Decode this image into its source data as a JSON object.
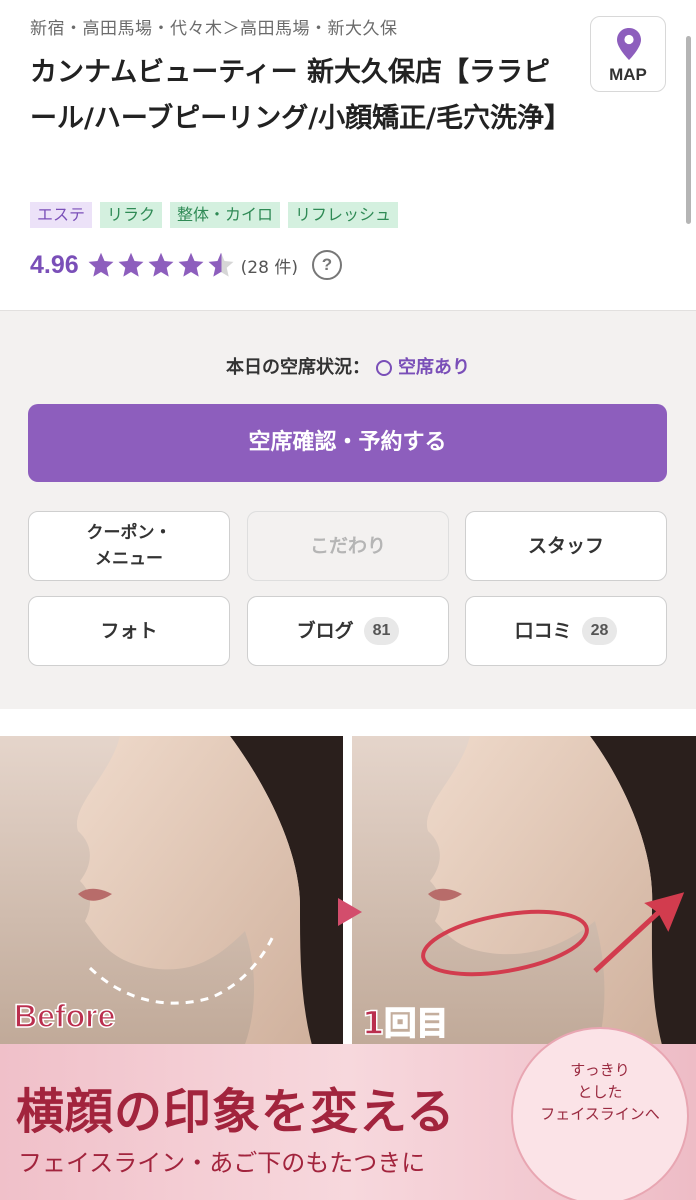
{
  "breadcrumb": "新宿・高田馬場・代々木＞高田馬場・新大久保",
  "salon": {
    "name": "カンナムビューティー 新大久保店【ララピール/ハーブピーリング/小顔矯正/毛穴洗浄】",
    "tags": [
      {
        "label": "エステ",
        "color": "purple"
      },
      {
        "label": "リラク",
        "color": "green"
      },
      {
        "label": "整体・カイロ",
        "color": "green"
      },
      {
        "label": "リフレッシュ",
        "color": "green"
      }
    ],
    "rating": "4.96",
    "rating_value": 4.96,
    "review_count": "(28 件)",
    "help_icon": "?"
  },
  "map_button": {
    "label": "MAP",
    "icon": "map-pin-icon"
  },
  "availability": {
    "label": "本日の空席状況：",
    "status_icon": "circle-icon",
    "status": "空席あり"
  },
  "reserve_button": "空席確認・予約する",
  "nav_buttons": {
    "coupon_line1": "クーポン・",
    "coupon_line2": "メニュー",
    "kodawari": "こだわり",
    "staff": "スタッフ",
    "photo": "フォト",
    "blog": "ブログ",
    "blog_count": "81",
    "reviews": "口コミ",
    "reviews_count": "28"
  },
  "banner": {
    "before_label": "Before",
    "after_label": "1回目",
    "headline": "横顔の印象を変える",
    "subline": "フェイスライン・あご下のもたつきに",
    "circle_line1": "すっきり",
    "circle_line2": "とした",
    "circle_line3": "フェイスラインへ"
  },
  "colors": {
    "accent": "#8d5ebd",
    "accent_text": "#7a4fb8",
    "tag_green_bg": "#d4f0df",
    "tag_purple_bg": "#ece2f8",
    "banner_text": "#a2243d",
    "banner_bg": "#f2c9d0"
  }
}
